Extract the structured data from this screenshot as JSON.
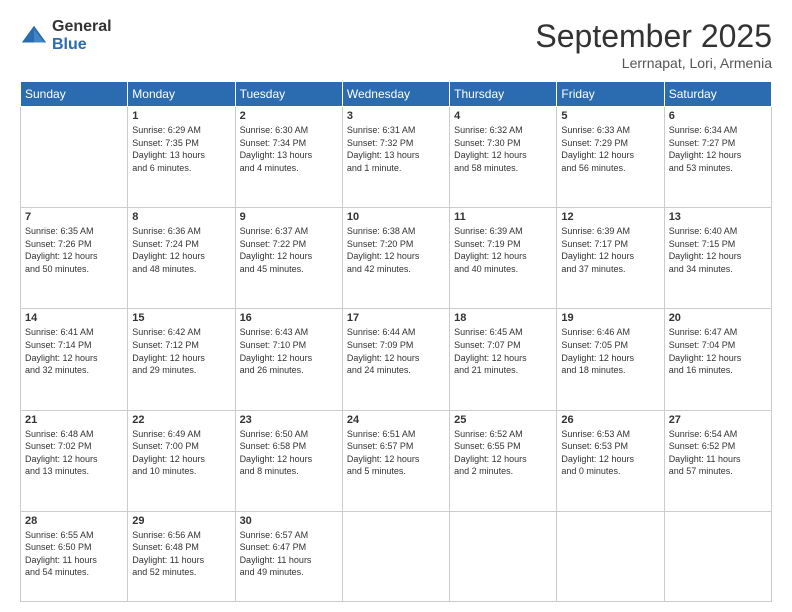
{
  "logo": {
    "general": "General",
    "blue": "Blue"
  },
  "title": "September 2025",
  "location": "Lerrnapat, Lori, Armenia",
  "days_header": [
    "Sunday",
    "Monday",
    "Tuesday",
    "Wednesday",
    "Thursday",
    "Friday",
    "Saturday"
  ],
  "weeks": [
    [
      {
        "day": "",
        "info": ""
      },
      {
        "day": "1",
        "info": "Sunrise: 6:29 AM\nSunset: 7:35 PM\nDaylight: 13 hours\nand 6 minutes."
      },
      {
        "day": "2",
        "info": "Sunrise: 6:30 AM\nSunset: 7:34 PM\nDaylight: 13 hours\nand 4 minutes."
      },
      {
        "day": "3",
        "info": "Sunrise: 6:31 AM\nSunset: 7:32 PM\nDaylight: 13 hours\nand 1 minute."
      },
      {
        "day": "4",
        "info": "Sunrise: 6:32 AM\nSunset: 7:30 PM\nDaylight: 12 hours\nand 58 minutes."
      },
      {
        "day": "5",
        "info": "Sunrise: 6:33 AM\nSunset: 7:29 PM\nDaylight: 12 hours\nand 56 minutes."
      },
      {
        "day": "6",
        "info": "Sunrise: 6:34 AM\nSunset: 7:27 PM\nDaylight: 12 hours\nand 53 minutes."
      }
    ],
    [
      {
        "day": "7",
        "info": "Sunrise: 6:35 AM\nSunset: 7:26 PM\nDaylight: 12 hours\nand 50 minutes."
      },
      {
        "day": "8",
        "info": "Sunrise: 6:36 AM\nSunset: 7:24 PM\nDaylight: 12 hours\nand 48 minutes."
      },
      {
        "day": "9",
        "info": "Sunrise: 6:37 AM\nSunset: 7:22 PM\nDaylight: 12 hours\nand 45 minutes."
      },
      {
        "day": "10",
        "info": "Sunrise: 6:38 AM\nSunset: 7:20 PM\nDaylight: 12 hours\nand 42 minutes."
      },
      {
        "day": "11",
        "info": "Sunrise: 6:39 AM\nSunset: 7:19 PM\nDaylight: 12 hours\nand 40 minutes."
      },
      {
        "day": "12",
        "info": "Sunrise: 6:39 AM\nSunset: 7:17 PM\nDaylight: 12 hours\nand 37 minutes."
      },
      {
        "day": "13",
        "info": "Sunrise: 6:40 AM\nSunset: 7:15 PM\nDaylight: 12 hours\nand 34 minutes."
      }
    ],
    [
      {
        "day": "14",
        "info": "Sunrise: 6:41 AM\nSunset: 7:14 PM\nDaylight: 12 hours\nand 32 minutes."
      },
      {
        "day": "15",
        "info": "Sunrise: 6:42 AM\nSunset: 7:12 PM\nDaylight: 12 hours\nand 29 minutes."
      },
      {
        "day": "16",
        "info": "Sunrise: 6:43 AM\nSunset: 7:10 PM\nDaylight: 12 hours\nand 26 minutes."
      },
      {
        "day": "17",
        "info": "Sunrise: 6:44 AM\nSunset: 7:09 PM\nDaylight: 12 hours\nand 24 minutes."
      },
      {
        "day": "18",
        "info": "Sunrise: 6:45 AM\nSunset: 7:07 PM\nDaylight: 12 hours\nand 21 minutes."
      },
      {
        "day": "19",
        "info": "Sunrise: 6:46 AM\nSunset: 7:05 PM\nDaylight: 12 hours\nand 18 minutes."
      },
      {
        "day": "20",
        "info": "Sunrise: 6:47 AM\nSunset: 7:04 PM\nDaylight: 12 hours\nand 16 minutes."
      }
    ],
    [
      {
        "day": "21",
        "info": "Sunrise: 6:48 AM\nSunset: 7:02 PM\nDaylight: 12 hours\nand 13 minutes."
      },
      {
        "day": "22",
        "info": "Sunrise: 6:49 AM\nSunset: 7:00 PM\nDaylight: 12 hours\nand 10 minutes."
      },
      {
        "day": "23",
        "info": "Sunrise: 6:50 AM\nSunset: 6:58 PM\nDaylight: 12 hours\nand 8 minutes."
      },
      {
        "day": "24",
        "info": "Sunrise: 6:51 AM\nSunset: 6:57 PM\nDaylight: 12 hours\nand 5 minutes."
      },
      {
        "day": "25",
        "info": "Sunrise: 6:52 AM\nSunset: 6:55 PM\nDaylight: 12 hours\nand 2 minutes."
      },
      {
        "day": "26",
        "info": "Sunrise: 6:53 AM\nSunset: 6:53 PM\nDaylight: 12 hours\nand 0 minutes."
      },
      {
        "day": "27",
        "info": "Sunrise: 6:54 AM\nSunset: 6:52 PM\nDaylight: 11 hours\nand 57 minutes."
      }
    ],
    [
      {
        "day": "28",
        "info": "Sunrise: 6:55 AM\nSunset: 6:50 PM\nDaylight: 11 hours\nand 54 minutes."
      },
      {
        "day": "29",
        "info": "Sunrise: 6:56 AM\nSunset: 6:48 PM\nDaylight: 11 hours\nand 52 minutes."
      },
      {
        "day": "30",
        "info": "Sunrise: 6:57 AM\nSunset: 6:47 PM\nDaylight: 11 hours\nand 49 minutes."
      },
      {
        "day": "",
        "info": ""
      },
      {
        "day": "",
        "info": ""
      },
      {
        "day": "",
        "info": ""
      },
      {
        "day": "",
        "info": ""
      }
    ]
  ]
}
